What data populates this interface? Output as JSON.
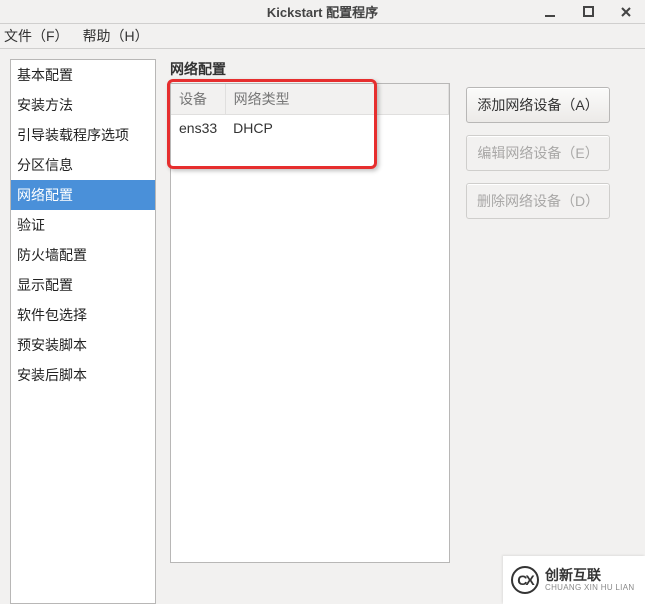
{
  "window": {
    "title": "Kickstart 配置程序"
  },
  "menu": {
    "file": "文件（F）",
    "help": "帮助（H）"
  },
  "sidebar": {
    "items": [
      {
        "label": "基本配置",
        "selected": false
      },
      {
        "label": "安装方法",
        "selected": false
      },
      {
        "label": "引导装载程序选项",
        "selected": false
      },
      {
        "label": "分区信息",
        "selected": false
      },
      {
        "label": "网络配置",
        "selected": true
      },
      {
        "label": "验证",
        "selected": false
      },
      {
        "label": "防火墙配置",
        "selected": false
      },
      {
        "label": "显示配置",
        "selected": false
      },
      {
        "label": "软件包选择",
        "selected": false
      },
      {
        "label": "预安装脚本",
        "selected": false
      },
      {
        "label": "安装后脚本",
        "selected": false
      }
    ]
  },
  "main": {
    "group_label": "网络配置",
    "table": {
      "col_device": "设备",
      "col_type": "网络类型",
      "rows": [
        {
          "device": "ens33",
          "type": "DHCP"
        }
      ]
    },
    "buttons": {
      "add": "添加网络设备（A）",
      "edit": "编辑网络设备（E）",
      "delete": "删除网络设备（D）"
    }
  },
  "watermark": {
    "zh": "创新互联",
    "en": "CHUANG XIN HU LIAN"
  }
}
